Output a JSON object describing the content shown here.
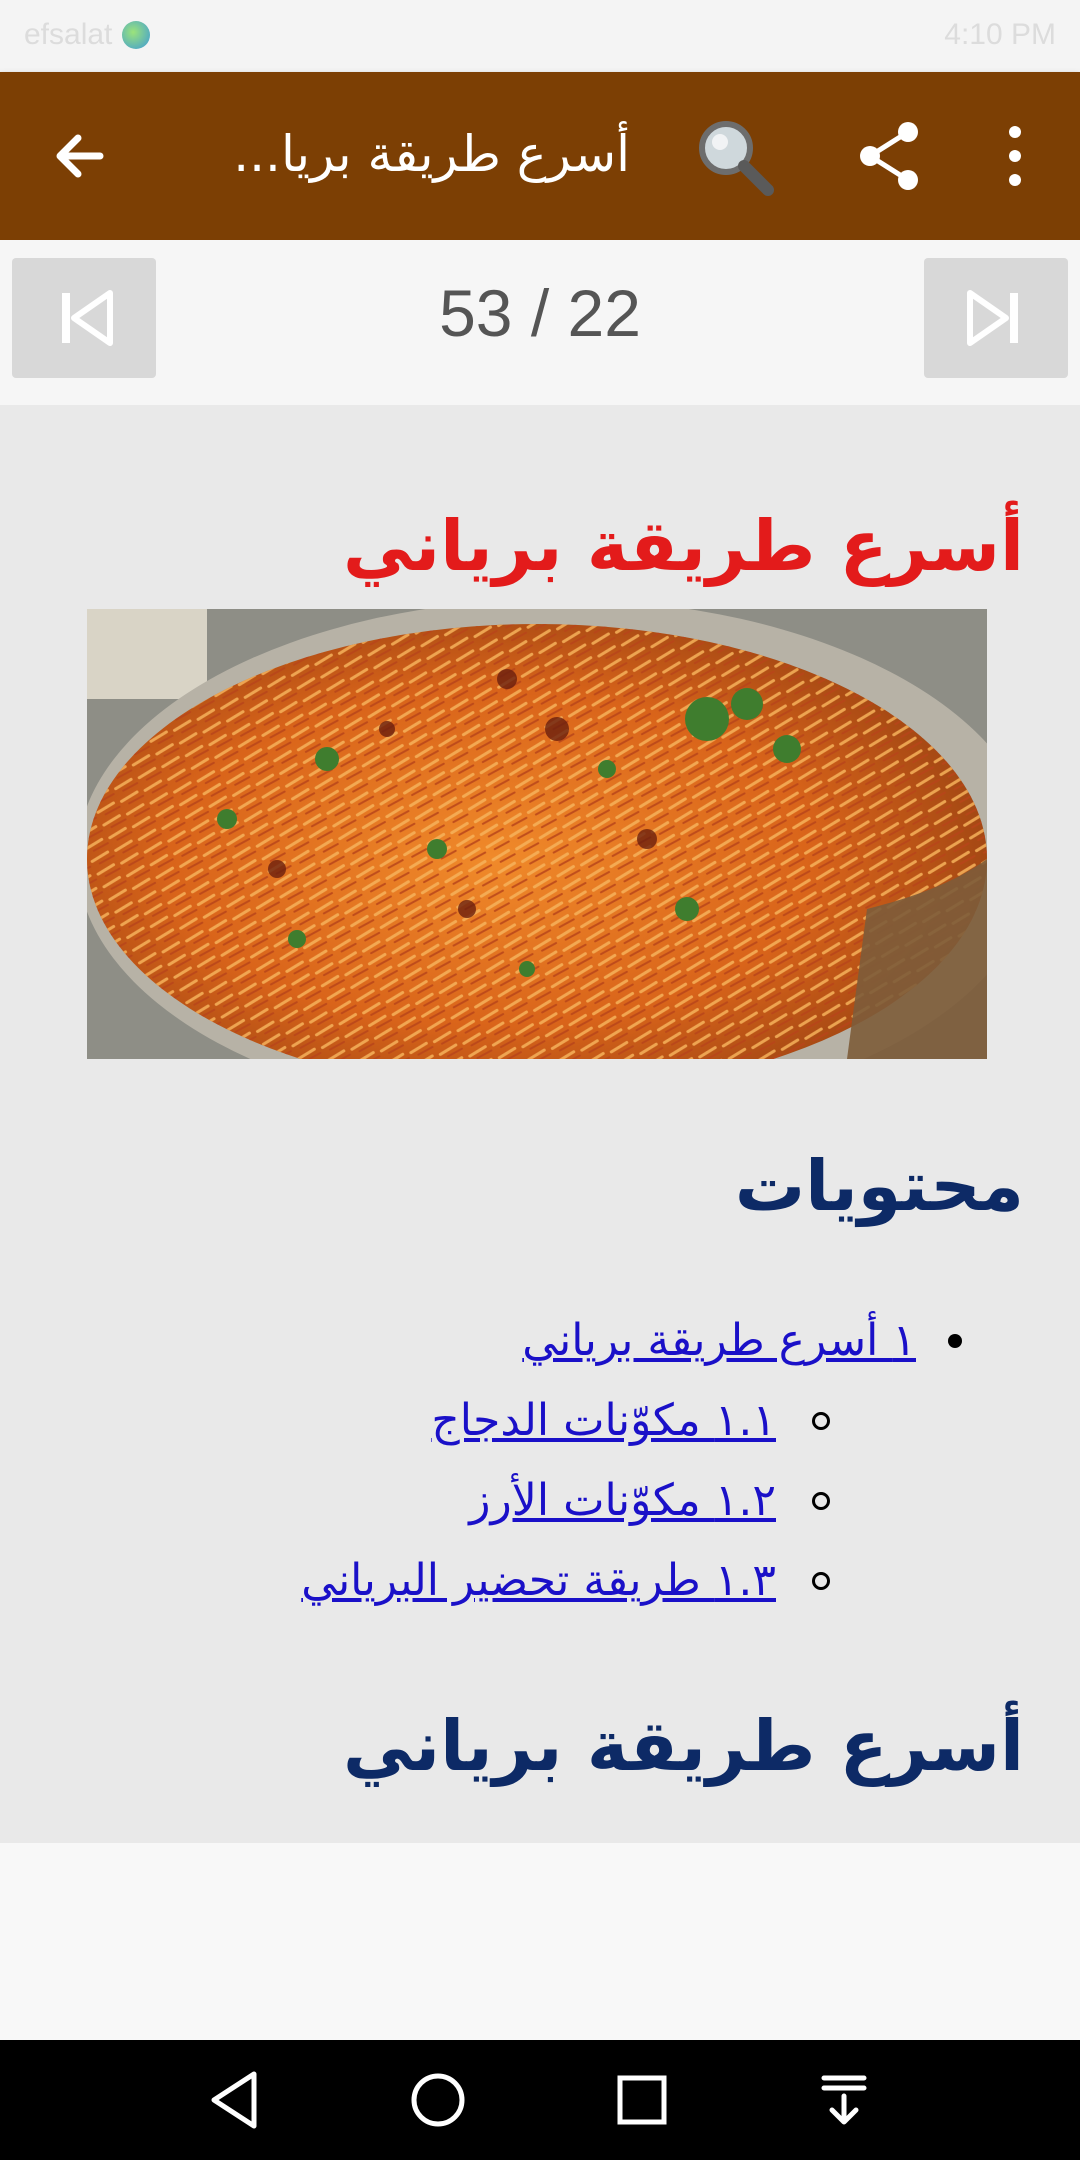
{
  "status_bar": {
    "left_text": "efsalat",
    "right_text": "4:10 PM"
  },
  "toolbar": {
    "title": "أسرع طريقة بريا...",
    "icons": [
      "back-arrow-icon",
      "search-icon",
      "share-icon",
      "more-vert-icon"
    ]
  },
  "pager": {
    "counter": "53 / 22",
    "icons": [
      "skip-previous-icon",
      "skip-next-icon"
    ]
  },
  "article": {
    "heading": "أسرع طريقة برياني",
    "image_alt_subject": "biryani-rice-photo",
    "toc_heading": "محتويات",
    "toc": [
      {
        "label": "١ أسرع طريقة برياني",
        "level": 1
      },
      {
        "label": "١.١ مكوّنات الدجاج",
        "level": 2
      },
      {
        "label": "١.٢ مكوّنات الأرز",
        "level": 2
      },
      {
        "label": "١.٣ طريقة تحضير البرياني",
        "level": 2
      }
    ],
    "section_heading": "أسرع طريقة برياني"
  },
  "colors": {
    "toolbar": "#7c3f04",
    "heading_red": "#e31b1b",
    "heading_navy": "#0d2a66",
    "link": "#1a10c8"
  },
  "navbar": {
    "icons": [
      "nav-back-icon",
      "nav-home-icon",
      "nav-recents-icon",
      "nav-notifications-icon"
    ]
  }
}
